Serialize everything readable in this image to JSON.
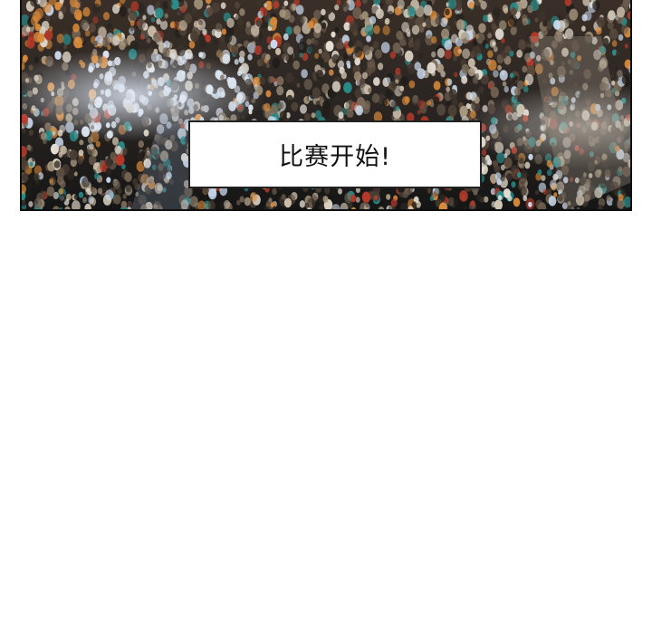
{
  "caption": {
    "text": "比赛开始!"
  },
  "panel": {
    "scene": "arena-crowd",
    "colors": {
      "dark": "#1a1a1a",
      "highlight_blue": "#c9d9ec",
      "accent_teal": "#2a8c8a",
      "accent_orange": "#d98a3a",
      "accent_red": "#b23a2a"
    }
  }
}
